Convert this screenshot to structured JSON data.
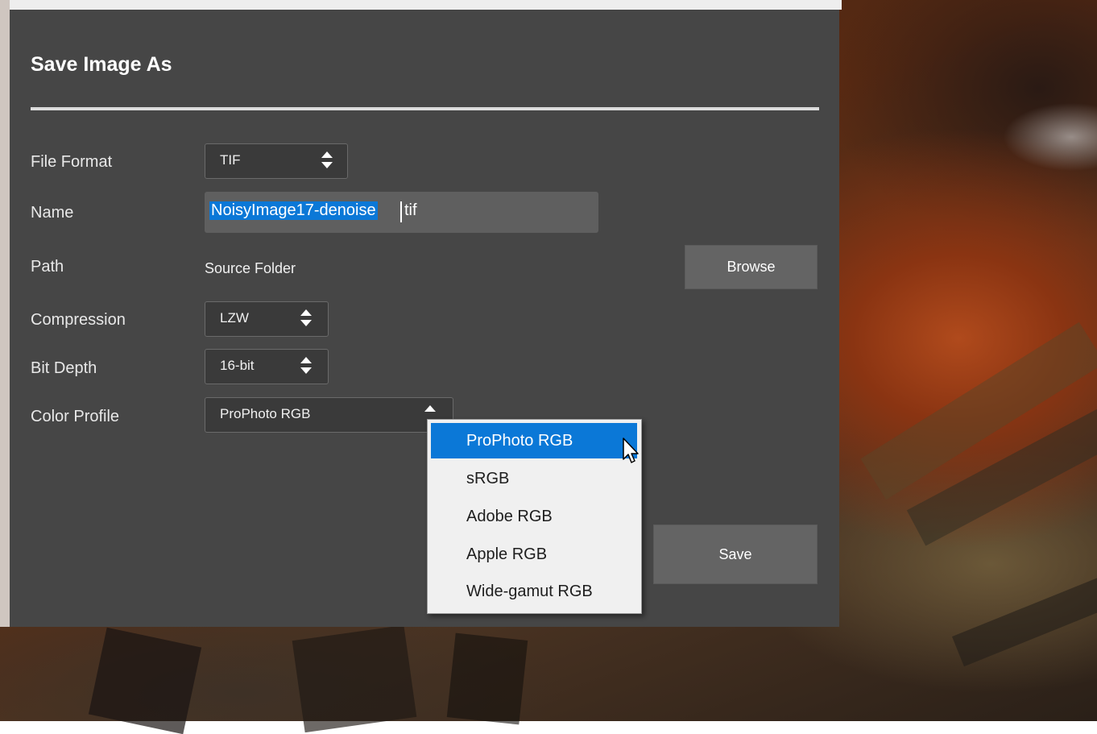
{
  "dialog": {
    "title": "Save Image As",
    "fields": {
      "file_format": {
        "label": "File Format",
        "value": "TIF"
      },
      "name": {
        "label": "Name",
        "selected_text": "NoisyImage17-denoise",
        "extension": "tif"
      },
      "path": {
        "label": "Path",
        "value": "Source Folder",
        "browse_label": "Browse"
      },
      "compression": {
        "label": "Compression",
        "value": "LZW"
      },
      "bit_depth": {
        "label": "Bit Depth",
        "value": "16-bit"
      },
      "color_profile": {
        "label": "Color Profile",
        "value": "ProPhoto RGB",
        "options": [
          "ProPhoto RGB",
          "sRGB",
          "Adobe RGB",
          "Apple RGB",
          "Wide-gamut RGB"
        ],
        "highlighted_option": "ProPhoto RGB"
      }
    },
    "save_label": "Save"
  },
  "colors": {
    "dialog_bg": "#464646",
    "selection_blue": "#0b78d7",
    "button_bg": "#646464",
    "menu_bg": "#f0f0f0"
  }
}
